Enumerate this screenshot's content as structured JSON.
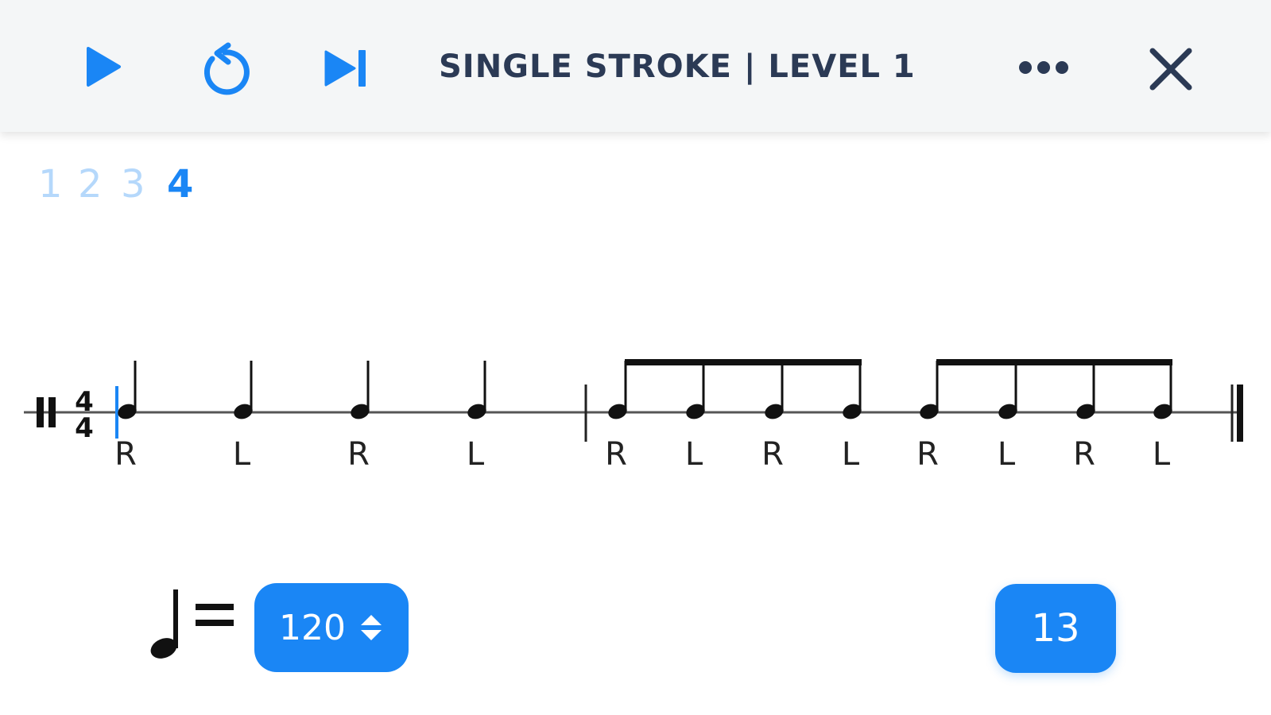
{
  "app": {
    "title": "SINGLE STROKE | LEVEL 1"
  },
  "toolbar": {
    "play_icon": "play-icon",
    "restart_icon": "restart-icon",
    "skip_icon": "skip-next-icon",
    "more_icon": "more-horizontal-icon",
    "close_icon": "close-icon"
  },
  "count_in": {
    "numbers": [
      "1",
      "2",
      "3",
      "4"
    ],
    "active_index": 3
  },
  "notation": {
    "time_signature": {
      "top": "4",
      "bottom": "4"
    },
    "sticking": [
      "R",
      "L",
      "R",
      "L",
      "R",
      "L",
      "R",
      "L",
      "R",
      "L",
      "R",
      "L"
    ]
  },
  "tempo": {
    "value": "120"
  },
  "counter": {
    "value": "13"
  },
  "colors": {
    "accent": "#1a86f5",
    "title": "#2b3a55",
    "topbar_bg": "#f4f6f7",
    "count_dim": "#b5d8fb"
  }
}
